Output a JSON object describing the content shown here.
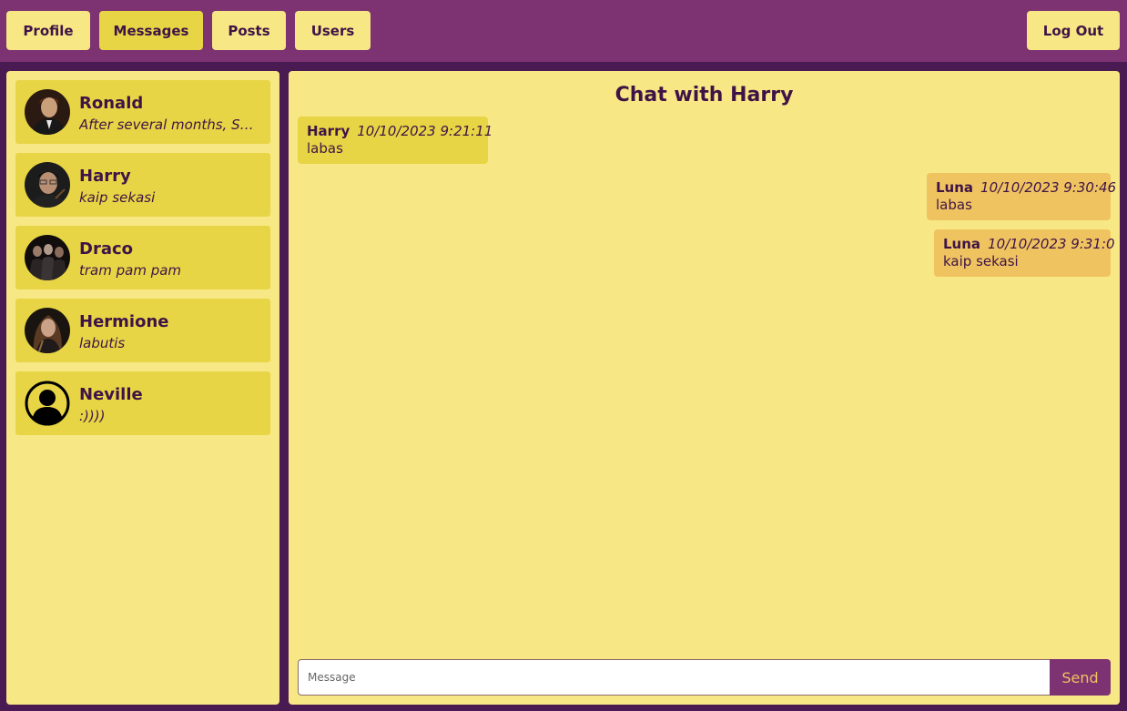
{
  "nav": {
    "profile": "Profile",
    "messages": "Messages",
    "posts": "Posts",
    "users": "Users",
    "logout": "Log Out"
  },
  "contacts": [
    {
      "name": "Ronald",
      "preview": "After several months, Skyler was finally ready to talk"
    },
    {
      "name": "Harry",
      "preview": "kaip sekasi"
    },
    {
      "name": "Draco",
      "preview": "tram pam pam"
    },
    {
      "name": "Hermione",
      "preview": "labutis"
    },
    {
      "name": "Neville",
      "preview": ":))))"
    }
  ],
  "chat": {
    "title": "Chat with Harry",
    "messages": [
      {
        "author": "Harry",
        "time": "10/10/2023 9:21:11",
        "text": "labas"
      },
      {
        "author": "Luna",
        "time": "10/10/2023 9:30:46",
        "text": "labas"
      },
      {
        "author": "Luna",
        "time": "10/10/2023 9:31:0",
        "text": "kaip sekasi"
      }
    ],
    "input_placeholder": "Message",
    "send_label": "Send"
  },
  "colors": {
    "topbar": "#7d3272",
    "background": "#4a1a52",
    "panel": "#f7e885",
    "item": "#e8d545",
    "own_message": "#f0c361",
    "text": "#3e1446"
  }
}
